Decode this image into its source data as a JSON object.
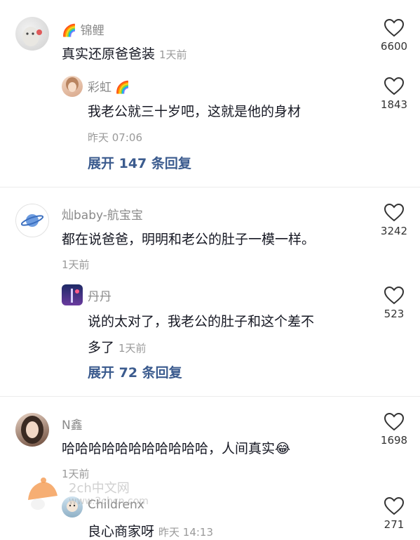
{
  "comments": [
    {
      "user": "锦鲤",
      "text": "真实还原爸爸装",
      "time": "1天前",
      "likes": "6600",
      "reply": {
        "user": "彩虹",
        "text": "我老公就三十岁吧，这就是他的身材",
        "time": "昨天 07:06",
        "likes": "1843"
      },
      "expand": "展开 147 条回复"
    },
    {
      "user": "灿baby-航宝宝",
      "text": "都在说爸爸，明明和老公的肚子一模一样。",
      "time": "1天前",
      "likes": "3242",
      "reply": {
        "user": "丹丹",
        "text_line1": "说的太对了，我老公的肚子和这个差不",
        "text_line2": "多了",
        "time": "1天前",
        "likes": "523"
      },
      "expand": "展开 72 条回复"
    },
    {
      "user": "N鑫",
      "text": "哈哈哈哈哈哈哈哈哈哈哈，人间真实",
      "time": "1天前",
      "likes": "1698",
      "reply": {
        "user": "Childrenx",
        "text": "良心商家呀",
        "time": "昨天 14:13",
        "likes": "271"
      }
    }
  ],
  "watermark": {
    "line1": "2ch中文网",
    "line2": "www.2chcn.com"
  },
  "icons": {
    "rainbow": "🌈",
    "laugh_cry": "😂",
    "heart": "heart-outline-icon"
  },
  "colors": {
    "text": "#161823",
    "muted": "#8a8a8a",
    "link": "#3b5b8e"
  }
}
